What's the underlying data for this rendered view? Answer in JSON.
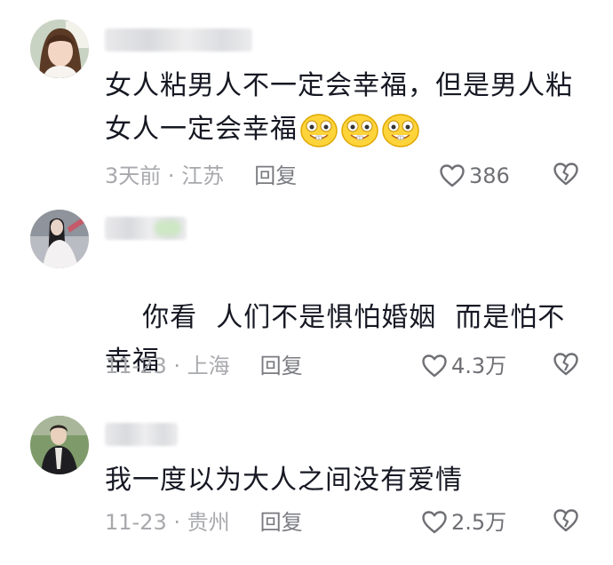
{
  "comments": [
    {
      "avatar_icon": "user-avatar-woman",
      "username": "",
      "text": "女人粘男人不一定会幸福，但是男人粘女人一定会幸福",
      "emojis": [
        "grin-emoji",
        "grin-emoji",
        "grin-emoji"
      ],
      "time": "3天前",
      "separator": "·",
      "location": "江苏",
      "reply_label": "回复",
      "likes": "386"
    },
    {
      "avatar_icon": "user-avatar-longhair",
      "username": "",
      "text": "你看  人们不是惧怕婚姻  而是怕不幸福",
      "emojis": [],
      "time": "11-23",
      "separator": "·",
      "location": "上海",
      "reply_label": "回复",
      "likes": "4.3万"
    },
    {
      "avatar_icon": "user-avatar-man",
      "username": "",
      "text": "我一度以为大人之间没有爱情",
      "emojis": [],
      "time": "11-23",
      "separator": "·",
      "location": "贵州",
      "reply_label": "回复",
      "likes": "2.5万"
    }
  ],
  "colors": {
    "text": "#161823",
    "meta": "#a8a9ad",
    "icon": "#6f7075"
  }
}
